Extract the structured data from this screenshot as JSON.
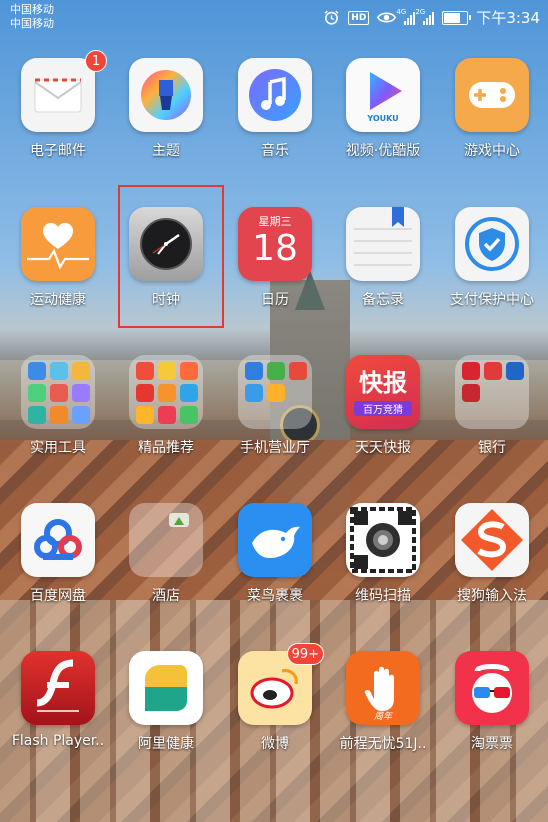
{
  "status_bar": {
    "carrier_1": "中国移动",
    "carrier_2": "中国移动",
    "signal_1_label": "4G",
    "signal_2_label": "2G",
    "hd_label": "HD",
    "battery_level": 0.7,
    "time": "下午3:34"
  },
  "apps": [
    {
      "label": "电子邮件",
      "icon": "mail-icon",
      "badge": "1"
    },
    {
      "label": "主题",
      "icon": "brush-icon"
    },
    {
      "label": "音乐",
      "icon": "music-note-icon"
    },
    {
      "label": "视频·优酷版",
      "icon": "play-icon",
      "sublabel": "YOUKU"
    },
    {
      "label": "游戏中心",
      "icon": "gamepad-icon"
    },
    {
      "label": "运动健康",
      "icon": "heart-pulse-icon"
    },
    {
      "label": "时钟",
      "icon": "clock-icon"
    },
    {
      "label": "日历",
      "icon": "calendar-icon",
      "weekday": "星期三",
      "day": "18"
    },
    {
      "label": "备忘录",
      "icon": "notepad-icon"
    },
    {
      "label": "支付保护中心",
      "icon": "shield-check-icon"
    },
    {
      "label": "实用工具",
      "icon": "folder-icon"
    },
    {
      "label": "精品推荐",
      "icon": "folder-icon"
    },
    {
      "label": "手机营业厅",
      "icon": "folder-icon"
    },
    {
      "label": "天天快报",
      "icon": "news-icon",
      "title": "快报",
      "subtitle": "百万竞猜"
    },
    {
      "label": "银行",
      "icon": "folder-icon"
    },
    {
      "label": "百度网盘",
      "icon": "cloud-icon"
    },
    {
      "label": "酒店",
      "icon": "hotel-icon"
    },
    {
      "label": "菜鸟裹裹",
      "icon": "bird-icon"
    },
    {
      "label": "维码扫描",
      "icon": "scanner-icon"
    },
    {
      "label": "搜狗输入法",
      "icon": "sogou-s-icon"
    },
    {
      "label": "Flash Player..",
      "icon": "flash-icon"
    },
    {
      "label": "阿里健康",
      "icon": "chat-bubble-icon"
    },
    {
      "label": "微博",
      "icon": "weibo-icon",
      "badge": "99+"
    },
    {
      "label": "前程无忧51J..",
      "icon": "hand-icon",
      "tag": "周年"
    },
    {
      "label": "淘票票",
      "icon": "glasses-icon"
    }
  ],
  "colors": {
    "highlight": "#e03a32",
    "badge": "#f24537"
  }
}
